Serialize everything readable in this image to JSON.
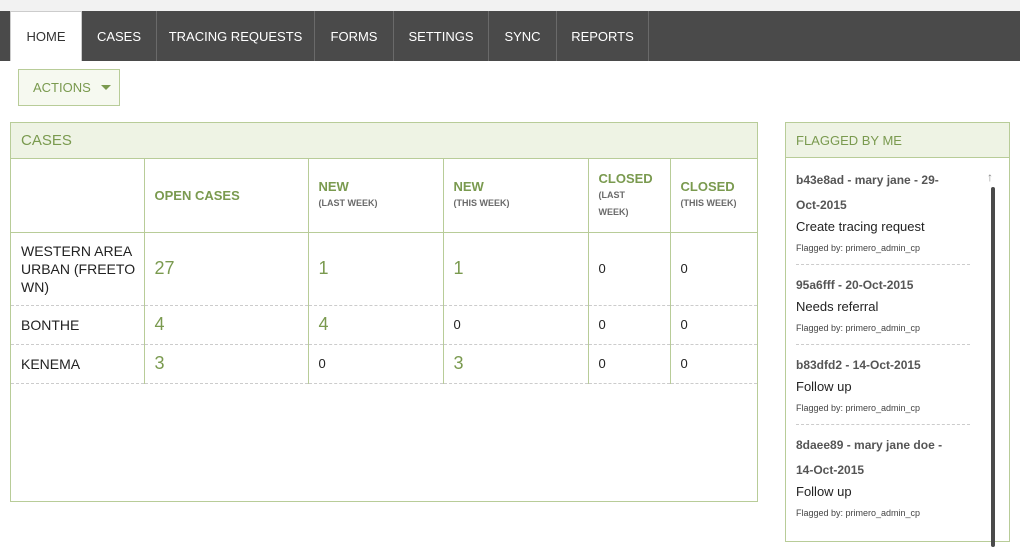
{
  "nav": {
    "tabs": [
      {
        "label": "HOME"
      },
      {
        "label": "CASES"
      },
      {
        "label": "TRACING REQUESTS"
      },
      {
        "label": "FORMS"
      },
      {
        "label": "SETTINGS"
      },
      {
        "label": "SYNC"
      },
      {
        "label": "REPORTS"
      }
    ],
    "active_tab": "HOME"
  },
  "actions": {
    "label": "ACTIONS",
    "icon": "chevron-down-icon"
  },
  "cases": {
    "title": "CASES",
    "columns": [
      {
        "main": "",
        "sub": ""
      },
      {
        "main": "OPEN CASES",
        "sub": ""
      },
      {
        "main": "NEW",
        "sub": "(LAST WEEK)"
      },
      {
        "main": "NEW",
        "sub": "(THIS WEEK)"
      },
      {
        "main": "CLOSED",
        "sub": "(LAST WEEK)"
      },
      {
        "main": "CLOSED",
        "sub": "(THIS WEEK)"
      }
    ],
    "rows": [
      {
        "region": "WESTERN AREA URBAN (FREETOWN)",
        "region_lines": [
          "WESTERN AREA",
          "URBAN (FREETO",
          "WN)"
        ],
        "open": "27",
        "new_last": "1",
        "new_this": "1",
        "closed_last": "0",
        "closed_this": "0"
      },
      {
        "region": "BONTHE",
        "region_lines": [
          "BONTHE"
        ],
        "open": "4",
        "new_last": "4",
        "new_this": "0",
        "closed_last": "0",
        "closed_this": "0"
      },
      {
        "region": "KENEMA",
        "region_lines": [
          "KENEMA"
        ],
        "open": "3",
        "new_last": "0",
        "new_this": "3",
        "closed_last": "0",
        "closed_this": "0"
      }
    ]
  },
  "flagged": {
    "title": "FLAGGED BY ME",
    "items": [
      {
        "title_lines": [
          "b43e8ad - mary jane - 29-",
          "Oct-2015"
        ],
        "description": "Create tracing request",
        "flagged_by": "Flagged by: primero_admin_cp"
      },
      {
        "title_lines": [
          "95a6fff - 20-Oct-2015"
        ],
        "description": "Needs referral",
        "flagged_by": "Flagged by: primero_admin_cp"
      },
      {
        "title_lines": [
          "b83dfd2 - 14-Oct-2015"
        ],
        "description": "Follow up",
        "flagged_by": "Flagged by: primero_admin_cp"
      },
      {
        "title_lines": [
          "8daee89 - mary jane doe -",
          "14-Oct-2015"
        ],
        "description": "Follow up",
        "flagged_by": "Flagged by: primero_admin_cp"
      }
    ]
  },
  "colors": {
    "accent": "#7a9a4f",
    "nav_bg": "#4a4a4a",
    "panel_border": "#b8cc98",
    "panel_header_bg": "#eef3e4"
  }
}
